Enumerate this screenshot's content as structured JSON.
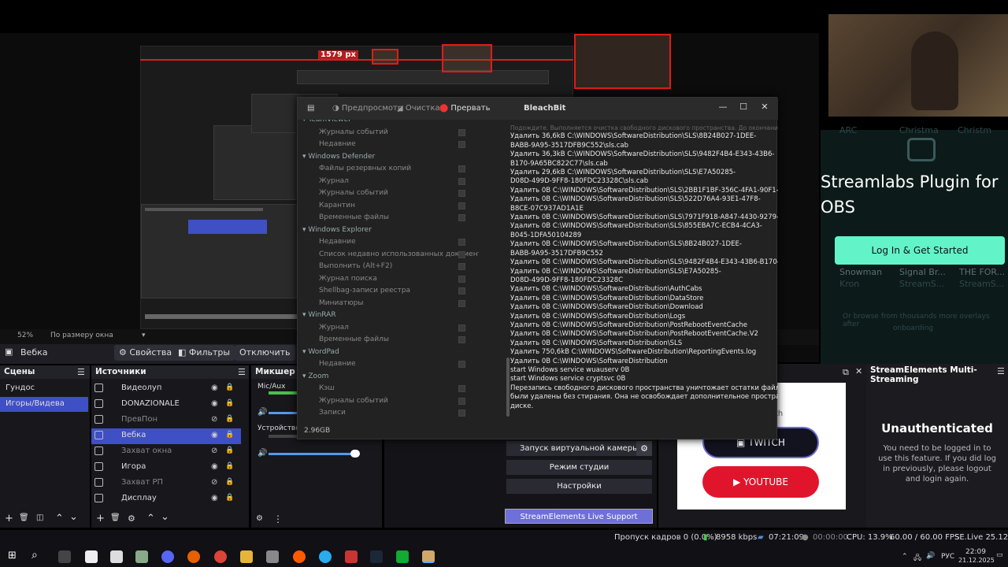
{
  "preview": {
    "ruler_label": "1579 px",
    "zoom": "52%",
    "fit_mode": "По размеру окна"
  },
  "streamlabs": {
    "title": "Streamlabs Plugin for OBS",
    "login_button": "Log In & Get Started",
    "faded": [
      "ARC",
      "Christma",
      "Christm",
      "Snowman",
      "Signal Br...",
      "THE FOR...",
      "Kron",
      "StreamS...",
      "StreamS...",
      "Or browse from thousands more overlays after",
      "onboarding"
    ]
  },
  "bleachbit": {
    "title": "BleachBit",
    "toolbar": {
      "preview": "Предпросмотр",
      "clean": "Очистка",
      "abort": "Прервать"
    },
    "tree": [
      {
        "label": "TeamViewer",
        "cat": true
      },
      {
        "label": "Журналы событий",
        "cat": false
      },
      {
        "label": "Недавние",
        "cat": false
      },
      {
        "label": "Windows Defender",
        "cat": true
      },
      {
        "label": "Файлы резервных копий",
        "cat": false
      },
      {
        "label": "Журнал",
        "cat": false
      },
      {
        "label": "Журналы событий",
        "cat": false
      },
      {
        "label": "Карантин",
        "cat": false
      },
      {
        "label": "Временные файлы",
        "cat": false
      },
      {
        "label": "Windows Explorer",
        "cat": true
      },
      {
        "label": "Недавние",
        "cat": false
      },
      {
        "label": "Список недавно использованных документов",
        "cat": false
      },
      {
        "label": "Выполнить (Alt+F2)",
        "cat": false
      },
      {
        "label": "Журнал поиска",
        "cat": false
      },
      {
        "label": "Shellbag-записи реестра",
        "cat": false
      },
      {
        "label": "Миниатюры",
        "cat": false
      },
      {
        "label": "WinRAR",
        "cat": true
      },
      {
        "label": "Журнал",
        "cat": false
      },
      {
        "label": "Временные файлы",
        "cat": false
      },
      {
        "label": "WordPad",
        "cat": true
      },
      {
        "label": "Недавние",
        "cat": false
      },
      {
        "label": "Zoom",
        "cat": true
      },
      {
        "label": "Кэш",
        "cat": false
      },
      {
        "label": "Журналы событий",
        "cat": false
      },
      {
        "label": "Записи",
        "cat": false
      }
    ],
    "log_header": "Подождите. Выполняется очистка свободного дискового пространства. До окончания осталось 32 минуты.",
    "log": [
      "Удалить 36,6kB C:\\WINDOWS\\SoftwareDistribution\\SLS\\8B24B027-1DEE-",
      "BABB-9A95-3517DFB9C552\\sls.cab",
      "Удалить 36,3kB C:\\WINDOWS\\SoftwareDistribution\\SLS\\9482F4B4-E343-43B6-",
      "B170-9A65BC822C77\\sls.cab",
      "Удалить 29,6kB C:\\WINDOWS\\SoftwareDistribution\\SLS\\E7A50285-",
      "D08D-499D-9FF8-180FDC23328C\\sls.cab",
      "Удалить 0B C:\\WINDOWS\\SoftwareDistribution\\SLS\\2BB1F1BF-356C-4FA1-90F1-7581A62C6764",
      "Удалить 0B C:\\WINDOWS\\SoftwareDistribution\\SLS\\522D76A4-93E1-47F8-",
      "B8CE-07C937AD1A1E",
      "Удалить 0B C:\\WINDOWS\\SoftwareDistribution\\SLS\\7971F918-A847-4430-9279-4A52D1EFE18D",
      "Удалить 0B C:\\WINDOWS\\SoftwareDistribution\\SLS\\855EBA7C-ECB4-4CA3-",
      "B045-1DFA50104289",
      "Удалить 0B C:\\WINDOWS\\SoftwareDistribution\\SLS\\8B24B027-1DEE-",
      "BABB-9A95-3517DFB9C552",
      "Удалить 0B C:\\WINDOWS\\SoftwareDistribution\\SLS\\9482F4B4-E343-43B6-B170-9A65BC822C77",
      "Удалить 0B C:\\WINDOWS\\SoftwareDistribution\\SLS\\E7A50285-",
      "D08D-499D-9FF8-180FDC23328C",
      "Удалить 0B C:\\WINDOWS\\SoftwareDistribution\\AuthCabs",
      "Удалить 0B C:\\WINDOWS\\SoftwareDistribution\\DataStore",
      "Удалить 0B C:\\WINDOWS\\SoftwareDistribution\\Download",
      "Удалить 0B C:\\WINDOWS\\SoftwareDistribution\\Logs",
      "Удалить 0B C:\\WINDOWS\\SoftwareDistribution\\PostRebootEventCache",
      "Удалить 0B C:\\WINDOWS\\SoftwareDistribution\\PostRebootEventCache.V2",
      "Удалить 0B C:\\WINDOWS\\SoftwareDistribution\\SLS",
      "Удалить 750,6kB C:\\WINDOWS\\SoftwareDistribution\\ReportingEvents.log",
      "Удалить 0B C:\\WINDOWS\\SoftwareDistribution",
      "start Windows service wuauserv 0B",
      "start Windows service cryptsvc 0B",
      "Перезапись свободного дискового пространства уничтожает остатки файлов, которые",
      "были удалены без стирания. Она не освобождает дополнительное пространство на",
      "диске."
    ],
    "status": "2.96GB"
  },
  "obs": {
    "selected_source": "Вебка",
    "props_btn": "Свойства",
    "filters_btn": "Фильтры",
    "disable_btn": "Отключить",
    "scenes_title": "Сцены",
    "scenes": [
      "Гундос",
      "Игоры/Видева"
    ],
    "sources_title": "Источники",
    "sources": [
      {
        "label": "Видеолуп",
        "dim": false,
        "sel": false
      },
      {
        "label": "DONAZIONALE",
        "dim": false,
        "sel": false
      },
      {
        "label": "ПревПон",
        "dim": true,
        "sel": false
      },
      {
        "label": "Вебка",
        "dim": false,
        "sel": true
      },
      {
        "label": "Захват окна",
        "dim": true,
        "sel": false
      },
      {
        "label": "Игора",
        "dim": false,
        "sel": false
      },
      {
        "label": "Захват РП",
        "dim": true,
        "sel": false
      },
      {
        "label": "Дисплау",
        "dim": false,
        "sel": false
      }
    ],
    "mixer_title": "Микшер зв",
    "mixer_ch1": "Mic/Aux",
    "mixer_ch2": "Устройство во",
    "controls": {
      "virtual_cam": "Запуск виртуальной камеры",
      "studio": "Режим студии",
      "settings": "Настройки",
      "se_support": "StreamElements Live Support"
    }
  },
  "chat": {
    "twitch": "TWITCH",
    "youtube": "YOUTUBE",
    "partial": "th"
  },
  "se_panel": {
    "title": "StreamElements Multi-Streaming",
    "heading": "Unauthenticated",
    "text": "You need to be logged in to use this feature. If you did log in previously, please logout and login again."
  },
  "status": {
    "dropped": "Пропуск кадров 0 (0.0%)",
    "bitrate": "8958 kbps",
    "stream_time": "07:21:09",
    "rec_time": "00:00:00",
    "cpu": "CPU: 13.9%",
    "fps": "60.00 / 60.00 FPS",
    "version": "SE.Live 25.12.15.5"
  },
  "taskbar": {
    "lang": "РУС",
    "time": "22:09",
    "date": "21.12.2025"
  }
}
